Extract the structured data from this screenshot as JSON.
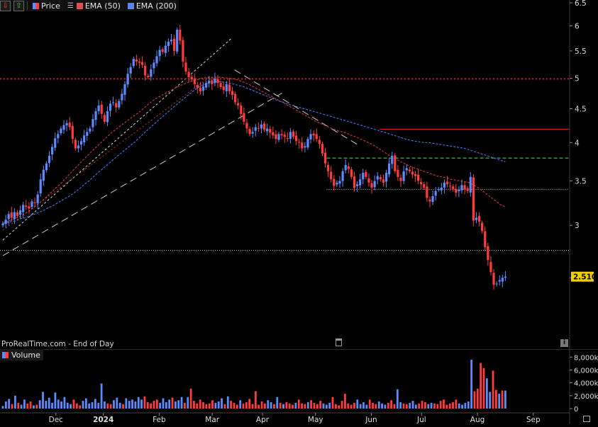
{
  "legend": {
    "price_label": "Price",
    "ema50_label": "EMA (50)",
    "ema200_label": "EMA (200)",
    "volume_label": "Volume",
    "down_icon": "arrow-down-icon",
    "up_icon": "arrow-up-icon"
  },
  "source_text": "ProRealTime.com - End of Day",
  "colors": {
    "up": "#5b8cff",
    "down": "#ff3b3b",
    "ema50": "#c03636",
    "ema200": "#3f6fe0",
    "resistance": "#e51515",
    "level_red": "#c81e1e",
    "level_green": "#27c52b",
    "level_white": "#d0d0d0",
    "last_price_bg": "#f0d000"
  },
  "chart_data": {
    "type": "candlestick",
    "title": "",
    "x_ticks": [
      "Dec",
      "2024",
      "Feb",
      "Mar",
      "Apr",
      "May",
      "Jun",
      "Jul",
      "Aug",
      "Sep"
    ],
    "y_ticks": [
      "2.5",
      "3",
      "3.5",
      "4",
      "4.5",
      "5",
      "5.5",
      "6",
      "6.5"
    ],
    "ylim": [
      2.0,
      6.5
    ],
    "xlim": [
      0,
      202
    ],
    "last_price": "2.510",
    "tick_positions": [
      19,
      36,
      56,
      75,
      93,
      112,
      132,
      150,
      170,
      190
    ],
    "closes": [
      3.02,
      3.06,
      3.12,
      3.08,
      3.14,
      3.1,
      3.16,
      3.22,
      3.2,
      3.18,
      3.26,
      3.24,
      3.34,
      3.52,
      3.64,
      3.72,
      3.82,
      3.94,
      4.06,
      4.12,
      4.2,
      4.25,
      4.28,
      4.22,
      4.05,
      3.92,
      3.96,
      4.02,
      4.1,
      4.15,
      4.2,
      4.34,
      4.46,
      4.55,
      4.42,
      4.3,
      4.46,
      4.58,
      4.6,
      4.52,
      4.62,
      4.74,
      4.9,
      5.08,
      5.2,
      5.35,
      5.3,
      5.28,
      5.24,
      5.05,
      5.02,
      5.16,
      5.28,
      5.4,
      5.52,
      5.48,
      5.6,
      5.68,
      5.72,
      5.5,
      5.92,
      5.7,
      5.3,
      5.12,
      5.02,
      4.98,
      4.9,
      4.84,
      4.78,
      4.86,
      4.92,
      4.96,
      4.9,
      5.0,
      4.92,
      4.85,
      4.8,
      4.9,
      4.78,
      4.72,
      4.6,
      4.55,
      4.42,
      4.3,
      4.2,
      4.12,
      4.15,
      4.22,
      4.2,
      4.26,
      4.18,
      4.2,
      4.14,
      4.1,
      4.05,
      4.12,
      4.1,
      4.08,
      4.06,
      4.15,
      4.08,
      4.02,
      4.0,
      3.92,
      3.95,
      4.05,
      4.12,
      4.1,
      4.05,
      3.98,
      3.85,
      3.72,
      3.62,
      3.52,
      3.44,
      3.48,
      3.5,
      3.62,
      3.7,
      3.65,
      3.55,
      3.42,
      3.46,
      3.52,
      3.6,
      3.55,
      3.48,
      3.42,
      3.5,
      3.56,
      3.52,
      3.48,
      3.6,
      3.72,
      3.82,
      3.62,
      3.55,
      3.5,
      3.62,
      3.66,
      3.62,
      3.58,
      3.56,
      3.5,
      3.46,
      3.42,
      3.3,
      3.26,
      3.32,
      3.38,
      3.4,
      3.42,
      3.48,
      3.46,
      3.44,
      3.4,
      3.36,
      3.4,
      3.45,
      3.4,
      3.38,
      3.55,
      3.05,
      3.08,
      3.04,
      2.94,
      2.78,
      2.66,
      2.55,
      2.44,
      2.45,
      2.48,
      2.5,
      2.51
    ],
    "ema50": [
      3.02,
      3.04,
      3.06,
      3.08,
      3.1,
      3.13,
      3.16,
      3.2,
      3.24,
      3.28,
      3.33,
      3.38,
      3.43,
      3.48,
      3.54,
      3.6,
      3.66,
      3.72,
      3.78,
      3.84,
      3.9,
      3.96,
      4.02,
      4.08,
      4.14,
      4.19,
      4.24,
      4.29,
      4.34,
      4.39,
      4.44,
      4.5,
      4.56,
      4.62,
      4.67,
      4.71,
      4.75,
      4.79,
      4.83,
      4.87,
      4.9,
      4.93,
      4.96,
      4.98,
      5.0,
      5.01,
      5.02,
      5.02,
      5.02,
      5.01,
      5.0,
      4.99,
      4.97,
      4.94,
      4.91,
      4.87,
      4.83,
      4.79,
      4.75,
      4.71,
      4.67,
      4.63,
      4.59,
      4.55,
      4.51,
      4.47,
      4.43,
      4.39,
      4.35,
      4.31,
      4.28,
      4.25,
      4.22,
      4.19,
      4.17,
      4.15,
      4.13,
      4.1,
      4.08,
      4.05,
      4.02,
      3.99,
      3.96,
      3.92,
      3.88,
      3.84,
      3.8,
      3.77,
      3.74,
      3.71,
      3.68,
      3.66,
      3.64,
      3.62,
      3.6,
      3.58,
      3.56,
      3.55,
      3.54,
      3.52,
      3.51,
      3.5,
      3.49,
      3.48,
      3.45,
      3.42,
      3.38,
      3.34,
      3.3,
      3.26,
      3.22,
      3.2
    ],
    "ema200": [
      3.02,
      3.03,
      3.04,
      3.05,
      3.07,
      3.08,
      3.1,
      3.12,
      3.14,
      3.16,
      3.19,
      3.21,
      3.24,
      3.27,
      3.3,
      3.33,
      3.37,
      3.41,
      3.46,
      3.5,
      3.55,
      3.6,
      3.65,
      3.7,
      3.75,
      3.8,
      3.85,
      3.9,
      3.95,
      4.0,
      4.06,
      4.12,
      4.18,
      4.24,
      4.3,
      4.36,
      4.42,
      4.48,
      4.54,
      4.6,
      4.66,
      4.72,
      4.78,
      4.84,
      4.88,
      4.91,
      4.93,
      4.94,
      4.94,
      4.93,
      4.92,
      4.9,
      4.88,
      4.86,
      4.83,
      4.8,
      4.77,
      4.74,
      4.71,
      4.68,
      4.65,
      4.62,
      4.6,
      4.57,
      4.55,
      4.53,
      4.51,
      4.49,
      4.47,
      4.45,
      4.43,
      4.41,
      4.39,
      4.37,
      4.35,
      4.33,
      4.31,
      4.29,
      4.27,
      4.25,
      4.23,
      4.21,
      4.19,
      4.17,
      4.15,
      4.13,
      4.11,
      4.09,
      4.07,
      4.05,
      4.03,
      4.02,
      4.01,
      4.0,
      4.0,
      3.99,
      3.98,
      3.97,
      3.96,
      3.95,
      3.94,
      3.93,
      3.92,
      3.9,
      3.88,
      3.86,
      3.84,
      3.82,
      3.8,
      3.78,
      3.76,
      3.74
    ],
    "levels": [
      {
        "kind": "resistance",
        "price": 4.99
      },
      {
        "kind": "level_red",
        "price": 4.19
      },
      {
        "kind": "level_green",
        "price": 3.79
      },
      {
        "kind": "level_white",
        "price": 3.4
      },
      {
        "kind": "level_white",
        "price": 2.75
      }
    ],
    "trendlines": [
      {
        "style": "dotted-white",
        "from": [
          0,
          2.85
        ],
        "to": [
          82,
          5.75
        ]
      },
      {
        "style": "dotted-red",
        "from": [
          0,
          2.95
        ],
        "to": [
          74,
          5.02
        ]
      },
      {
        "style": "dashed-white",
        "from": [
          0,
          2.7
        ],
        "to": [
          100,
          4.75
        ]
      },
      {
        "style": "dashed-white",
        "from": [
          83,
          5.15
        ],
        "to": [
          128,
          3.95
        ]
      }
    ],
    "volume_ticks": [
      "0",
      "2,000k",
      "4,000k",
      "6,000k",
      "8,000k"
    ],
    "volume_ylim": [
      0,
      8800
    ],
    "volume": [
      400,
      1100,
      1500,
      700,
      2000,
      900,
      600,
      1400,
      800,
      1100,
      500,
      600,
      1300,
      2600,
      1200,
      1700,
      900,
      2500,
      1400,
      1100,
      1800,
      900,
      700,
      1400,
      800,
      500,
      1200,
      1600,
      800,
      1000,
      1500,
      900,
      3900,
      1100,
      800,
      700,
      1300,
      1700,
      900,
      700,
      1600,
      1200,
      1400,
      1100,
      1800,
      1400,
      1900,
      1000,
      800,
      1200,
      1400,
      900,
      1600,
      1000,
      1400,
      1700,
      1100,
      1300,
      1800,
      900,
      1800,
      3100,
      1200,
      800,
      1400,
      1000,
      700,
      800,
      1300,
      900,
      1100,
      1600,
      700,
      1900,
      1200,
      900,
      600,
      1300,
      800,
      1000,
      1500,
      700,
      2700,
      600,
      1100,
      800,
      1300,
      1000,
      700,
      1800,
      900,
      700,
      1000,
      800,
      600,
      900,
      1400,
      800,
      700,
      1000,
      1300,
      900,
      700,
      1200,
      800,
      600,
      900,
      1800,
      700,
      500,
      1200,
      2300,
      800,
      600,
      900,
      1400,
      700,
      1000,
      600,
      1400,
      900,
      700,
      1100,
      800,
      600,
      900,
      1300,
      700,
      3000,
      1000,
      800,
      700,
      900,
      1200,
      600,
      800,
      1200,
      1000,
      700,
      900,
      800,
      700,
      1200,
      1400,
      600,
      800,
      1000,
      1400,
      800,
      600,
      900,
      1100,
      7600,
      2700,
      3100,
      7100,
      6300,
      4700,
      2600,
      5900,
      2900,
      2300,
      2800,
      2800
    ],
    "vol_up": [
      1,
      1,
      1,
      0,
      1,
      0,
      1,
      1,
      0,
      0,
      1,
      0,
      1,
      1,
      1,
      1,
      1,
      1,
      1,
      1,
      1,
      1,
      1,
      0,
      0,
      0,
      1,
      1,
      1,
      1,
      1,
      1,
      1,
      1,
      0,
      0,
      1,
      1,
      1,
      0,
      1,
      1,
      1,
      1,
      1,
      1,
      0,
      0,
      0,
      0,
      0,
      1,
      1,
      1,
      1,
      0,
      1,
      1,
      1,
      0,
      1,
      0,
      0,
      0,
      0,
      0,
      0,
      0,
      0,
      1,
      1,
      1,
      0,
      1,
      0,
      0,
      0,
      1,
      0,
      0,
      0,
      0,
      0,
      0,
      0,
      0,
      1,
      1,
      0,
      1,
      0,
      1,
      0,
      0,
      0,
      1,
      0,
      0,
      0,
      1,
      0,
      0,
      0,
      0,
      1,
      1,
      1,
      0,
      0,
      0,
      0,
      0,
      0,
      0,
      0,
      1,
      1,
      1,
      1,
      0,
      0,
      0,
      1,
      1,
      1,
      0,
      0,
      0,
      1,
      1,
      0,
      0,
      1,
      1,
      1,
      0,
      0,
      0,
      1,
      1,
      0,
      0,
      0,
      0,
      0,
      0,
      0,
      0,
      1,
      1,
      1,
      1,
      1,
      0,
      0,
      0,
      0,
      1,
      1,
      0,
      0,
      1,
      0,
      1,
      0,
      0,
      0,
      0,
      0,
      0,
      0,
      1,
      1,
      1,
      1
    ]
  }
}
